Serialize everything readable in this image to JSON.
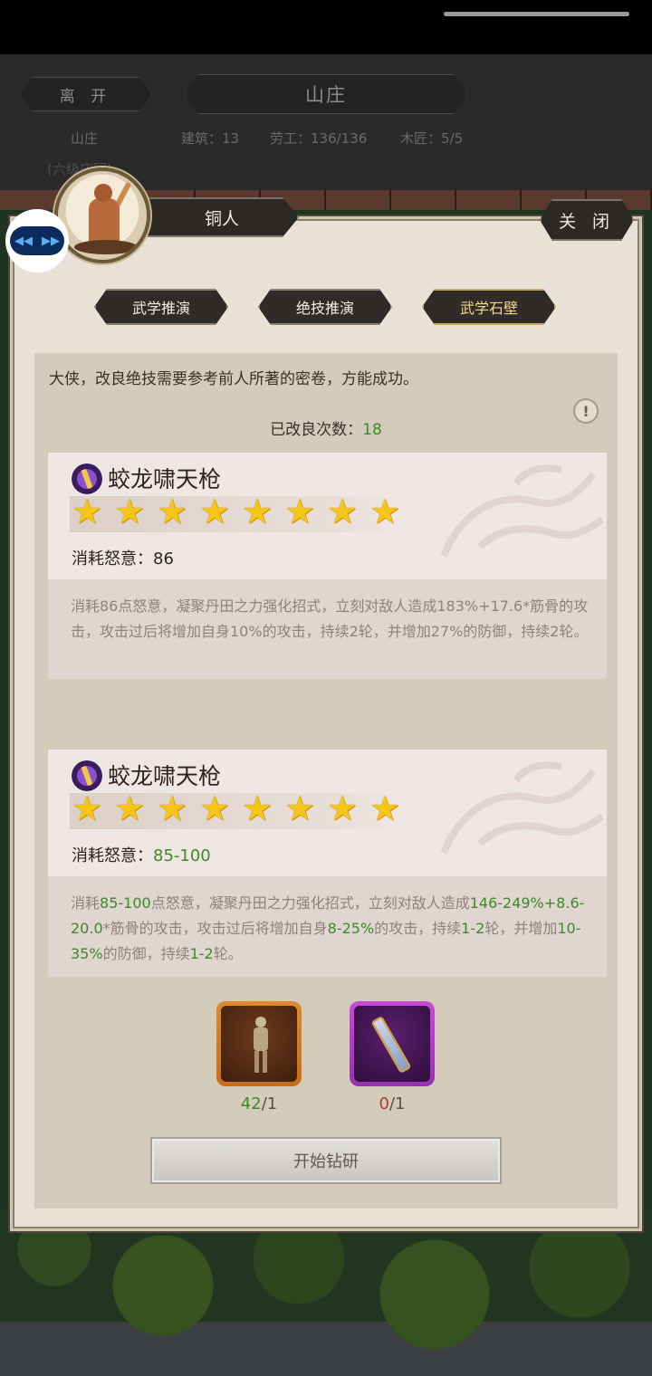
{
  "header": {
    "leave_label": "离 开",
    "title": "山庄",
    "location": "山庄",
    "buildings": "建筑：13",
    "labor": "劳工：136/136",
    "carpenter": "木匠：5/5",
    "sub": "(六级庄园)"
  },
  "dialog": {
    "character_name": "铜人",
    "close_label": "关 闭",
    "tabs": [
      {
        "label": "武学推演",
        "active": false
      },
      {
        "label": "绝技推演",
        "active": false
      },
      {
        "label": "武学石壁",
        "active": true
      }
    ],
    "intro": "大侠，改良绝技需要参考前人所著的密卷，方能成功。",
    "info_icon": "!",
    "improved_label": "已改良次数：",
    "improved_count": "18"
  },
  "current_skill": {
    "name": "蛟龙啸天枪",
    "stars": 8,
    "cost_label": "消耗怒意：",
    "cost_value": "86",
    "description": "消耗86点怒意，凝聚丹田之力强化招式，立刻对敌人造成183%+17.6*筋骨的攻击，攻击过后将增加自身10%的攻击，持续2轮，并增加27%的防御，持续2轮。"
  },
  "next_skill": {
    "name": "蛟龙啸天枪",
    "stars": 8,
    "cost_label": "消耗怒意：",
    "cost_value": "85-100",
    "desc_parts": {
      "p1": "消耗",
      "v1": "85-100",
      "p2": "点怒意，凝聚丹田之力强化招式，立刻对敌人造成",
      "v2": "146-249%",
      "p3": "+",
      "v3": "8.6-20.0",
      "p4": "*筋骨的攻击，攻击过后将增加自身",
      "v4": "8-25%",
      "p5": "的攻击，持续",
      "v5": "1-2",
      "p6": "轮，并增加",
      "v6": "10-35%",
      "p7": "的防御，持续",
      "v7": "1-2",
      "p8": "轮。"
    }
  },
  "materials": [
    {
      "icon": "bronze-figure-icon",
      "have": "42",
      "need": "/1",
      "rarity_color": "#e08a2c"
    },
    {
      "icon": "scroll-icon",
      "have": "0",
      "need": "/1",
      "rarity_color": "#c94ad8"
    }
  ],
  "start_label": "开始钻研",
  "colors": {
    "positive": "#3c8a28",
    "negative": "#b03a2e",
    "star": "#f5c518"
  }
}
